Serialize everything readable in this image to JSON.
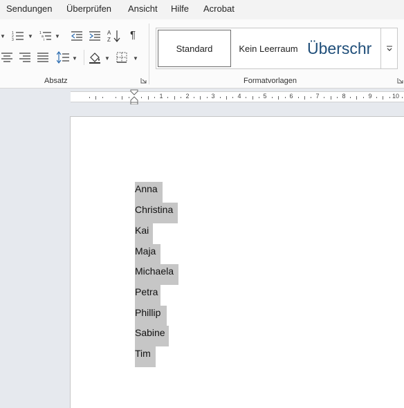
{
  "menu": {
    "items": [
      "Sendungen",
      "Überprüfen",
      "Ansicht",
      "Hilfe",
      "Acrobat"
    ]
  },
  "ribbon": {
    "groups": {
      "paragraph": {
        "label": "Absatz"
      },
      "styles": {
        "label": "Formatvorlagen",
        "tiles": [
          "Standard",
          "Kein Leerraum",
          "Überschr"
        ]
      }
    },
    "icons": {
      "pilcrow": "¶",
      "sort": "A↓Z"
    }
  },
  "ruler": {
    "labels": [
      "1",
      "2",
      "3",
      "4",
      "5",
      "6",
      "7",
      "8",
      "9",
      "10"
    ]
  },
  "document": {
    "lines": [
      "Anna",
      "Christina",
      "Kai",
      "Maja",
      "Michaela",
      "Petra",
      "Phillip",
      "Sabine",
      "Tim"
    ],
    "selected": true,
    "highlight_color": "#c6c6c6"
  },
  "colors": {
    "heading_style": "#1f4e79",
    "page_background": "#ffffff",
    "workspace_background": "#e6e9ee"
  }
}
